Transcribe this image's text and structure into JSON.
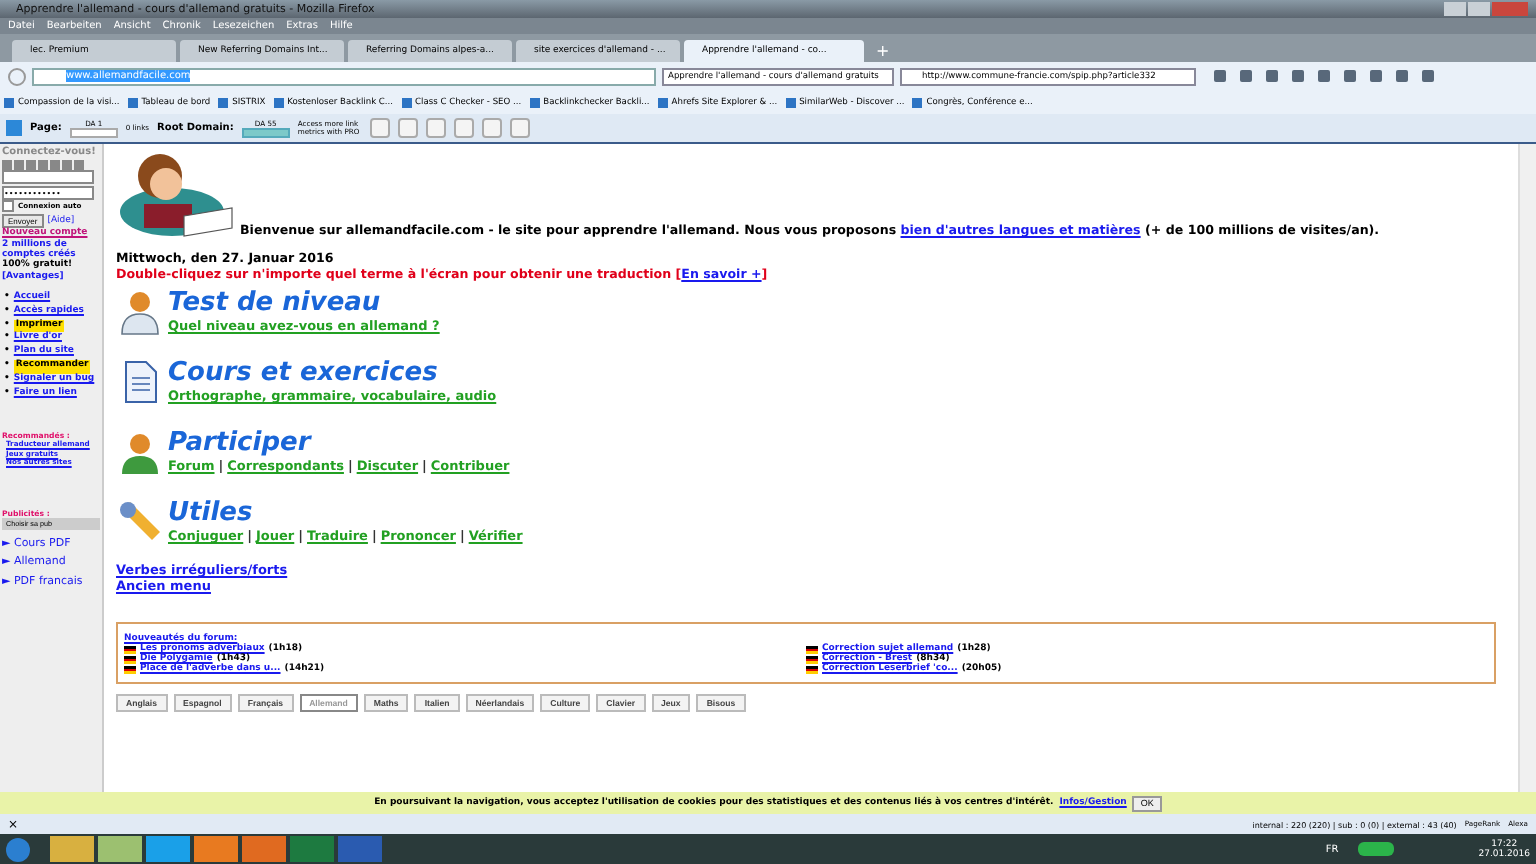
{
  "window": {
    "title": "Apprendre l'allemand - cours d'allemand gratuits - Mozilla Firefox"
  },
  "menu": [
    "Datei",
    "Bearbeiten",
    "Ansicht",
    "Chronik",
    "Lesezeichen",
    "Extras",
    "Hilfe"
  ],
  "tabs": [
    {
      "label": "lec. Premium",
      "selected": false
    },
    {
      "label": "New Referring Domains Int...",
      "selected": false
    },
    {
      "label": "Referring Domains alpes-a...",
      "selected": false
    },
    {
      "label": "site exercices d'allemand - ...",
      "selected": false
    },
    {
      "label": "Apprendre l'allemand - co...",
      "selected": true
    }
  ],
  "new_tab": "+",
  "address_bar": {
    "value": "www.allemandfacile.com",
    "search_value": "Apprendre l'allemand - cours d'allemand gratuits",
    "second_url": "http://www.commune-francie.com/spip.php?article332"
  },
  "bookmarks": [
    "Compassion de la visi...",
    "Tableau de bord",
    "SISTRIX",
    "Kostenloser Backlink C...",
    "Class C Checker - SEO ...",
    "Backlinkchecker Backli...",
    "Ahrefs Site Explorer & ...",
    "SimilarWeb - Discover ...",
    "Congrès, Conférence e..."
  ],
  "seo_bar": {
    "page_label": "Page:",
    "page_da": "DA 1",
    "page_links": "0 links",
    "root_label": "Root Domain:",
    "root_da": "DA 55",
    "pro_text": "Access more link metrics with PRO"
  },
  "sidebar": {
    "login_title": "Connectez-vous!",
    "password": "••••••••••••",
    "auto_login": {
      "label": "Connexion auto",
      "checked": false
    },
    "submit": "Envoyer",
    "help": "[Aide]",
    "new_account": "Nouveau compte",
    "accounts": "2 millions de comptes créés",
    "free": "100% gratuit!",
    "advantages": "[Avantages]",
    "nav": [
      {
        "marker": "•",
        "label": "Accueil",
        "highlighted": false
      },
      {
        "marker": "•",
        "label": "Accès rapides",
        "highlighted": false
      },
      {
        "marker": "•",
        "label": "Imprimer",
        "highlighted": true
      },
      {
        "marker": "•",
        "label": "Livre d'or",
        "highlighted": false
      },
      {
        "marker": "•",
        "label": "Plan du site",
        "highlighted": false
      },
      {
        "marker": "•",
        "label": "Recommander",
        "highlighted": true
      },
      {
        "marker": "•",
        "label": "Signaler un bug",
        "highlighted": false
      },
      {
        "marker": "•",
        "label": "Faire un lien",
        "highlighted": false
      }
    ],
    "recommended_title": "Recommandés :",
    "recommended": [
      "Traducteur allemand",
      "Jeux gratuits",
      "Nos autres sites"
    ],
    "ads_title": "Publicités :",
    "ads_choice": "Choisir sa pub",
    "pdf_links": [
      "► Cours PDF",
      "► Allemand",
      "► PDF francais"
    ]
  },
  "welcome": {
    "text": "Bienvenue sur allemandfacile.com - le site pour apprendre l'allemand. Nous vous proposons",
    "link": "bien d'autres langues et matières",
    "suffix": "(+ de 100 millions de visites/an)."
  },
  "date": "Mittwoch, den 27. Januar 2016",
  "tip": {
    "text": "Double-cliquez sur n'importe quel terme à l'écran pour obtenir une traduction",
    "open": "[",
    "link": "En savoir +",
    "close": "]"
  },
  "sections": [
    {
      "kind": "test",
      "title": "Test de niveau",
      "links": [
        "Quel niveau avez-vous en allemand ?"
      ]
    },
    {
      "kind": "courses",
      "title": "Cours et exercices",
      "links": [
        "Orthographe, grammaire, vocabulaire, audio"
      ]
    },
    {
      "kind": "participate",
      "title": "Participer",
      "links": [
        "Forum",
        "Correspondants",
        "Discuter",
        "Contribuer"
      ],
      "separators": [
        "|",
        "|",
        "|"
      ]
    },
    {
      "kind": "tools",
      "title": "Utiles",
      "links": [
        "Conjuguer",
        "Jouer",
        "Traduire",
        "Prononcer",
        "Vérifier"
      ],
      "separators": [
        "|",
        "|",
        "|",
        "|"
      ]
    }
  ],
  "extra_links": [
    "Verbes irréguliers/forts",
    "Ancien menu"
  ],
  "forum": {
    "title": "Nouveautés du forum:",
    "items": [
      {
        "title": "Les pronoms adverbiaux",
        "time": "(1h18)"
      },
      {
        "title": "Correction sujet allemand",
        "time": "(1h28)"
      },
      {
        "title": "Die Polygamie",
        "time": "(1h43)"
      },
      {
        "title": "Correction - Brest",
        "time": "(8h34)"
      },
      {
        "title": "Place de l'adverbe dans u...",
        "time": "(14h21)"
      },
      {
        "title": "Correction Leserbrief 'co...",
        "time": "(20h05)"
      }
    ]
  },
  "subject_tabs": [
    {
      "label": "Anglais",
      "selected": false
    },
    {
      "label": "Espagnol",
      "selected": false
    },
    {
      "label": "Français",
      "selected": false
    },
    {
      "label": "Allemand",
      "selected": true
    },
    {
      "label": "Maths",
      "selected": false
    },
    {
      "label": "Italien",
      "selected": false
    },
    {
      "label": "Néerlandais",
      "selected": false
    },
    {
      "label": "Culture",
      "selected": false
    },
    {
      "label": "Clavier",
      "selected": false
    },
    {
      "label": "Jeux",
      "selected": false
    },
    {
      "label": "Bisous",
      "selected": false
    }
  ],
  "cookie_bar": {
    "text": "En poursuivant la navigation, vous acceptez l'utilisation de cookies pour des statistiques et des contenus liés à vos centres d'intérêt.",
    "link": "Infos/Gestion",
    "button": "OK"
  },
  "status_bar": {
    "close": "×",
    "links": "internal : 220 (220) | sub : 0 (0) | external : 43 (40)",
    "pagerank": "PageRank",
    "alexa": "Alexa"
  },
  "taskbar": {
    "language": "FR",
    "time": "17:22",
    "date": "27.01.2016"
  }
}
